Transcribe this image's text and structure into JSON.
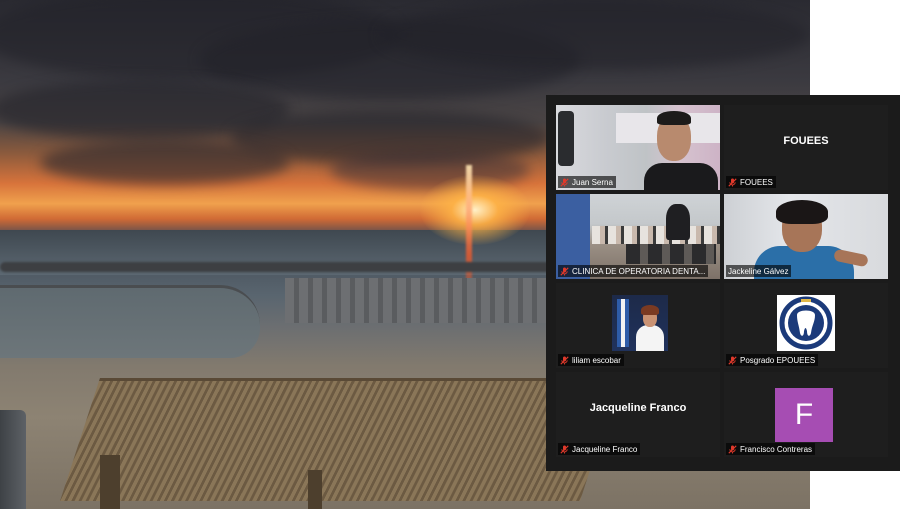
{
  "background": {
    "accent_sun": "#f0a14d"
  },
  "gallery": {
    "participants": [
      {
        "display_name": "Juan Serna",
        "tile_label": "",
        "video": "camera",
        "muted": true,
        "active_speaker": false
      },
      {
        "display_name": "FOUEES",
        "tile_label": "FOUEES",
        "video": "off",
        "muted": true,
        "active_speaker": false
      },
      {
        "display_name": "CLINICA DE OPERATORIA DENTA...",
        "tile_label": "",
        "video": "camera",
        "muted": true,
        "active_speaker": false
      },
      {
        "display_name": "Jackeline Gálvez",
        "tile_label": "",
        "video": "camera",
        "muted": false,
        "active_speaker": true
      },
      {
        "display_name": "liliam escobar",
        "tile_label": "",
        "video": "photo",
        "muted": true,
        "active_speaker": false
      },
      {
        "display_name": "Posgrado EPOUEES",
        "tile_label": "",
        "video": "logo",
        "muted": true,
        "active_speaker": false
      },
      {
        "display_name": "Jacqueline Franco",
        "tile_label": "Jacqueline Franco",
        "video": "off",
        "muted": true,
        "active_speaker": false
      },
      {
        "display_name": "Francisco Contreras",
        "tile_label": "",
        "video": "avatar",
        "avatar_letter": "F",
        "avatar_color": "#a64db3",
        "muted": true,
        "active_speaker": false
      }
    ],
    "active_speaker_color": "#b8d96a",
    "muted_icon_color": "#e0392b"
  }
}
